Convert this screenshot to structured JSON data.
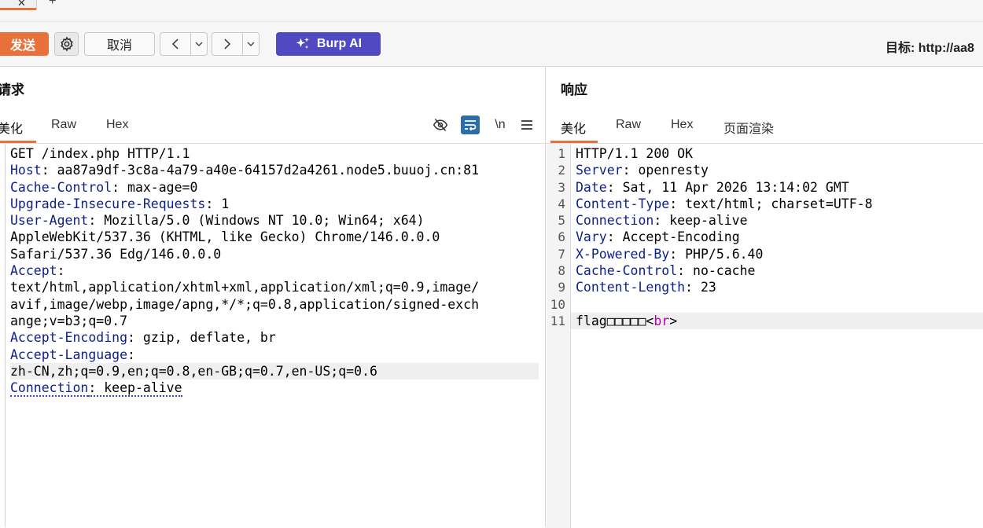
{
  "tabs": {
    "close_glyph": "✕",
    "add_glyph": "+"
  },
  "toolbar": {
    "send_label": "发送",
    "cancel_label": "取消",
    "burp_ai_label": "Burp AI",
    "target_label": "目标: http://aa8",
    "icons": [
      "gear-icon",
      "chevron-left-icon",
      "chevron-right-icon",
      "chevron-down-icon",
      "sparkle-icon"
    ]
  },
  "request": {
    "title": "请求",
    "tabs": [
      "美化",
      "Raw",
      "Hex"
    ],
    "tools": {
      "newline": "\\n",
      "icons": [
        "eye-off-icon",
        "wrap-icon",
        "menu-icon"
      ]
    },
    "lines": [
      {
        "key": "",
        "value": "GET /index.php HTTP/1.1"
      },
      {
        "key": "Host",
        "value": ": aa87a9df-3c8a-4a79-a40e-64157d2a4261.node5.buuoj.cn:81"
      },
      {
        "key": "Cache-Control",
        "value": ": max-age=0"
      },
      {
        "key": "Upgrade-Insecure-Requests",
        "value": ": 1"
      },
      {
        "key": "User-Agent",
        "value": ": Mozilla/5.0 (Windows NT 10.0; Win64; x64)"
      },
      {
        "key": "",
        "value": "AppleWebKit/537.36 (KHTML, like Gecko) Chrome/146.0.0.0"
      },
      {
        "key": "",
        "value": "Safari/537.36 Edg/146.0.0.0"
      },
      {
        "key": "Accept",
        "value": ":"
      },
      {
        "key": "",
        "value": "text/html,application/xhtml+xml,application/xml;q=0.9,image/"
      },
      {
        "key": "",
        "value": "avif,image/webp,image/apng,*/*;q=0.8,application/signed-exch"
      },
      {
        "key": "",
        "value": "ange;v=b3;q=0.7"
      },
      {
        "key": "Accept-Encoding",
        "value": ": gzip, deflate, br"
      },
      {
        "key": "Accept-Language",
        "value": ":"
      },
      {
        "key": "",
        "value": "zh-CN,zh;q=0.9,en;q=0.8,en-GB;q=0.7,en-US;q=0.6"
      },
      {
        "key": "Connection",
        "value": ": keep-alive"
      }
    ]
  },
  "response": {
    "title": "响应",
    "tabs": [
      "美化",
      "Raw",
      "Hex",
      "页面渲染"
    ],
    "line_numbers": [
      "1",
      "2",
      "3",
      "4",
      "5",
      "6",
      "7",
      "8",
      "9",
      "10",
      "11"
    ],
    "lines": [
      {
        "key": "",
        "value": "HTTP/1.1 200 OK"
      },
      {
        "key": "Server",
        "value": ": openresty"
      },
      {
        "key": "Date",
        "value": ": Sat, 11 Apr 2026 13:14:02 GMT"
      },
      {
        "key": "Content-Type",
        "value": ": text/html; charset=UTF-8"
      },
      {
        "key": "Connection",
        "value": ": keep-alive"
      },
      {
        "key": "Vary",
        "value": ": Accept-Encoding"
      },
      {
        "key": "X-Powered-By",
        "value": ": PHP/5.6.40"
      },
      {
        "key": "Cache-Control",
        "value": ": no-cache"
      },
      {
        "key": "Content-Length",
        "value": ": 23"
      },
      {
        "key": "",
        "value": ""
      },
      {
        "key": "",
        "value": "flag□□□□□<",
        "tag": "br",
        "tail": ">"
      }
    ]
  }
}
